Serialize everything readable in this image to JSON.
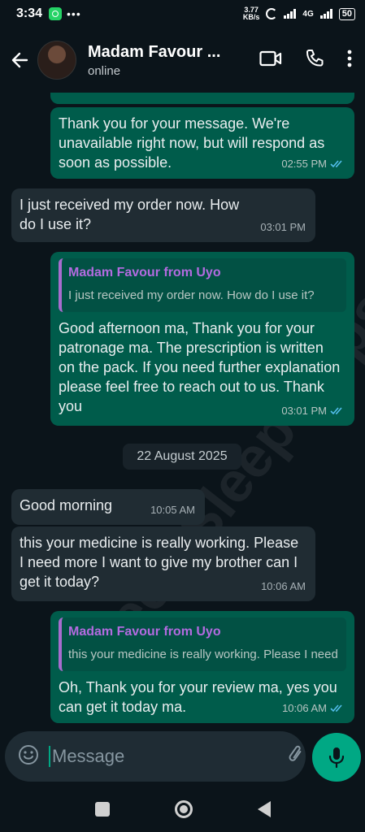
{
  "status_bar": {
    "time": "3:34",
    "speed_value": "3.77",
    "speed_unit": "KB/s",
    "network": "4G",
    "battery": "50"
  },
  "header": {
    "contact_name": "Madam Favour ...",
    "contact_status": "online",
    "icons": [
      "back-arrow-icon",
      "video-call-icon",
      "phone-call-icon",
      "more-options-icon"
    ]
  },
  "watermark": "Deep Sleep Capsules",
  "messages": [
    {
      "direction": "outgoing",
      "text": "Thank you for your message. We're unavailable right now, but will respond as soon as possible.",
      "time": "02:55 PM",
      "read": true
    },
    {
      "direction": "incoming",
      "text": "I just received my order now. How do I use it?",
      "time": "03:01 PM"
    },
    {
      "direction": "outgoing",
      "quote_author": "Madam Favour from Uyo",
      "quote_text": "I just received my order now. How do I use it?",
      "text": "Good afternoon ma, Thank you for your patronage ma. The prescription is written on the pack. If you need further explanation please feel free to reach out to us. Thank you",
      "time": "03:01 PM",
      "read": true
    },
    {
      "direction": "incoming",
      "text": "Good morning",
      "time": "10:05 AM"
    },
    {
      "direction": "incoming",
      "text": "this your medicine is really working. Please I need more I want to give my brother can I get it today?",
      "time": "10:06 AM"
    },
    {
      "direction": "outgoing",
      "quote_author": "Madam Favour from Uyo",
      "quote_text": "this your medicine is really working. Please I need more I want to give my brother can I get it today?",
      "text": "Oh, Thank you for your review ma, yes you can get it today ma.",
      "time": "10:06 AM",
      "read": true
    }
  ],
  "date_separator": "22 August 2025",
  "input": {
    "placeholder": "Message"
  },
  "colors": {
    "background": "#0b141a",
    "outgoing_bubble": "#005c4b",
    "incoming_bubble": "#202c33",
    "accent": "#00a884",
    "read_tick": "#53bdeb",
    "quote_author": "#b36be0"
  }
}
